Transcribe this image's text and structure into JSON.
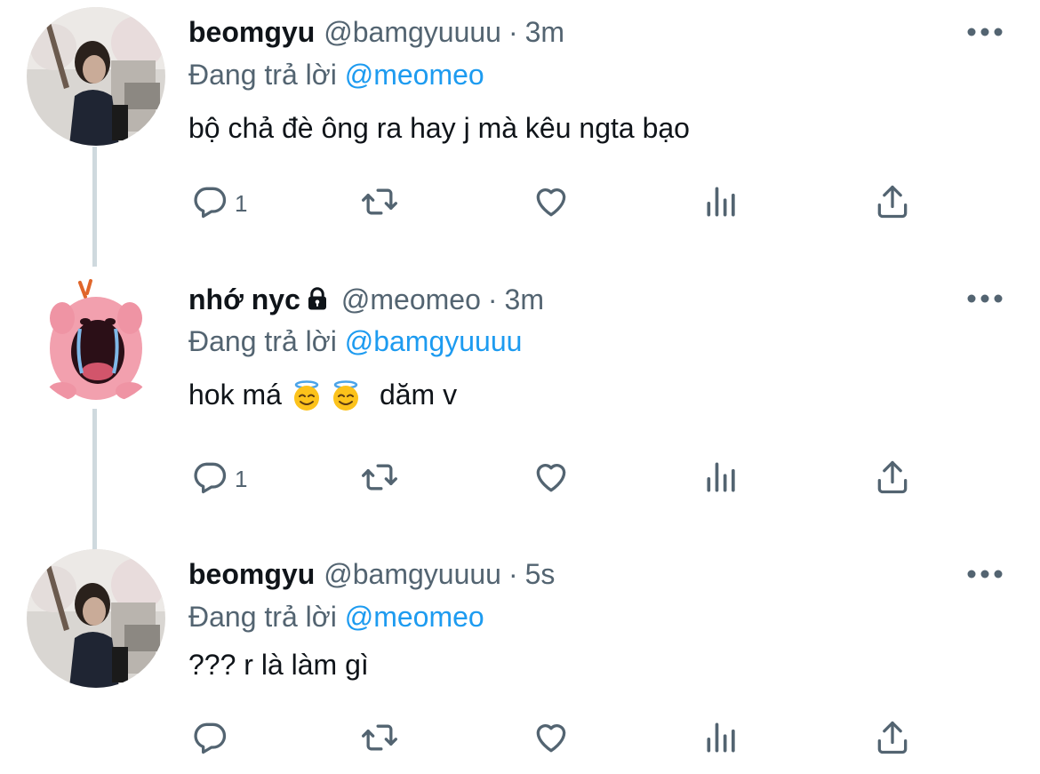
{
  "tweets": [
    {
      "name": "beomgyu",
      "handle": "@bamgyuuuu",
      "separator": "·",
      "time": "3m",
      "replying_prefix": "Đang trả lời",
      "replying_to": "@meomeo",
      "text": "bộ chả đè ông ra hay j mà kêu ngta bạo",
      "reply_count": "1",
      "locked": false
    },
    {
      "name": "nhớ nyc",
      "handle": "@meomeo",
      "separator": "·",
      "time": "3m",
      "replying_prefix": "Đang trả lời",
      "replying_to": "@bamgyuuuu",
      "text_before": "hok má",
      "text_after": "dăm v",
      "emojis": [
        "smiling-face-with-halo",
        "smiling-face-with-halo"
      ],
      "reply_count": "1",
      "locked": true
    },
    {
      "name": "beomgyu",
      "handle": "@bamgyuuuu",
      "separator": "·",
      "time": "5s",
      "replying_prefix": "Đang trả lời",
      "replying_to": "@meomeo",
      "text": "??? r là làm gì",
      "reply_count": "",
      "locked": false
    }
  ],
  "colors": {
    "text": "#0f1419",
    "secondary": "#536471",
    "mention": "#1d9bf0",
    "thread_line": "#cfd9de"
  }
}
